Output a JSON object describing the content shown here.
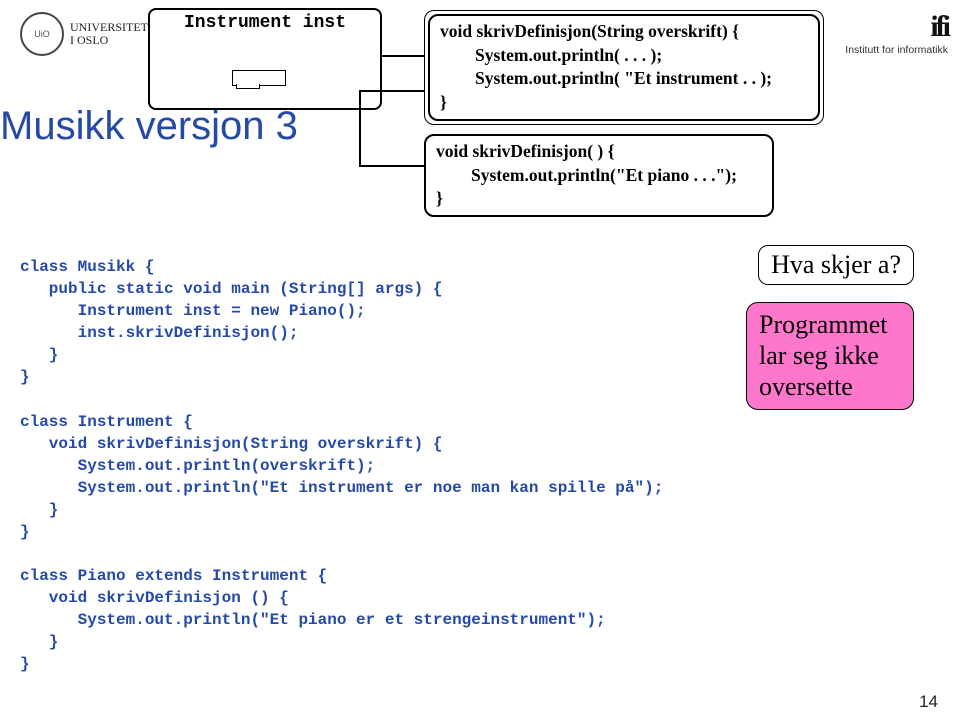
{
  "university": {
    "line1": "UNIVERSITETET",
    "line2": "I OSLO"
  },
  "ifi": {
    "glyph": "ifi",
    "subtitle": "Institutt for informatikk"
  },
  "title": "Musikk versjon 3",
  "instrument_label": "Instrument inst",
  "box1": {
    "l1": "void skrivDefinisjon(String overskrift) {",
    "l2": "        System.out.println( . . . );",
    "l3": "        System.out.println( \"Et instrument . . );",
    "l4": "}"
  },
  "box2": {
    "l1": "void skrivDefinisjon( ) {",
    "l2": "        System.out.println(\"Et piano . . .\");",
    "l3": "}"
  },
  "code": {
    "c01": "class Musikk {",
    "c02": "   public static void main (String[] args) {",
    "c03": "      Instrument inst = new Piano();",
    "c04": "      inst.skrivDefinisjon();",
    "c05": "   }",
    "c06": "}",
    "c07": "",
    "c08": "class Instrument {",
    "c09": "   void skrivDefinisjon(String overskrift) {",
    "c10": "      System.out.println(overskrift);",
    "c11": "      System.out.println(\"Et instrument er noe man kan spille på\");",
    "c12": "   }",
    "c13": "}",
    "c14": "",
    "c15": "class Piano extends Instrument {",
    "c16": "   void skrivDefinisjon () {",
    "c17": "      System.out.println(\"Et piano er et strengeinstrument\");",
    "c18": "   }",
    "c19": "}"
  },
  "question": "Hva skjer a?",
  "answer": "Programmet lar seg ikke oversette",
  "page": "14"
}
